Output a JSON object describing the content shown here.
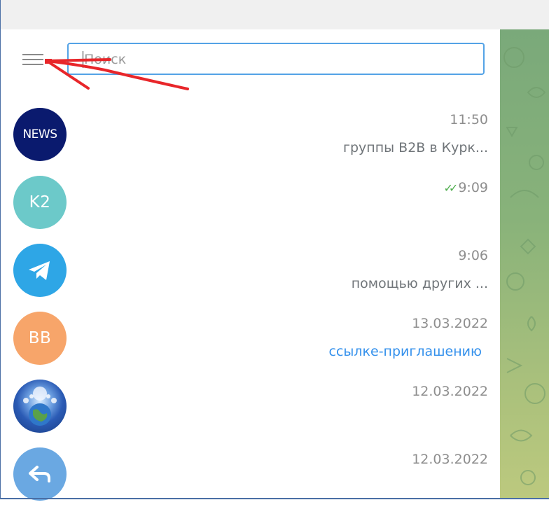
{
  "search": {
    "placeholder": "Поиск"
  },
  "chats": [
    {
      "avatar_text": "NEWS",
      "avatar_color": "#0a1a6e",
      "time": "11:50",
      "preview": "группы B2B в Курк..."
    },
    {
      "avatar_text": "K2",
      "avatar_color": "#6cc9c9",
      "time": "9:09",
      "preview": "",
      "read_ticks": "✓✓"
    },
    {
      "avatar_icon": "telegram-plane-icon",
      "avatar_color": "#2ea6e6",
      "time": "9:06",
      "preview": "помощью других ..."
    },
    {
      "avatar_text": "BB",
      "avatar_color": "#f7a56a",
      "time": "13.03.2022",
      "preview": "ссылке-приглашению"
    },
    {
      "avatar_icon": "earth-photo",
      "time": "12.03.2022",
      "preview": ""
    },
    {
      "avatar_icon": "reply-arrow-icon",
      "avatar_color": "#6aa8e2",
      "time": "12.03.2022",
      "preview": ""
    }
  ],
  "annotation": {
    "color": "#e8262a"
  }
}
